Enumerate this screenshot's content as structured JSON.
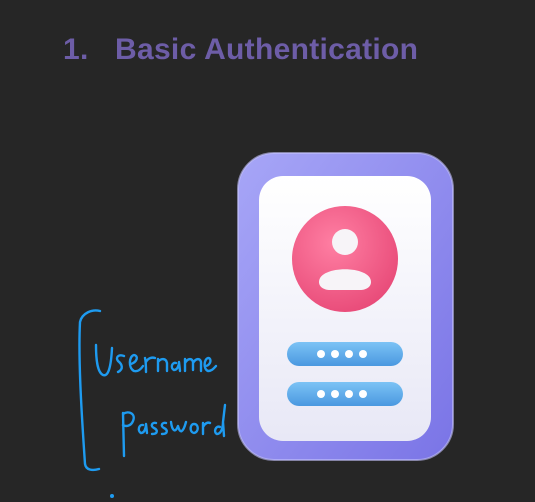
{
  "slide": {
    "number": "1.",
    "title": "Basic Authentication"
  },
  "illustration": {
    "icon": "phone-login-icon",
    "avatar_icon": "user-avatar-icon",
    "field_masks": [
      "••••",
      "••••"
    ]
  },
  "annotations": {
    "handwritten_lines": [
      "Username",
      "Password"
    ]
  },
  "colors": {
    "background": "#262626",
    "title": "#6d5da7",
    "phone_frame": "#8f8cf0",
    "phone_screen": "#f4f4fb",
    "avatar": "#f0557f",
    "field": "#5aa9e8",
    "ink": "#1e9bf0"
  }
}
